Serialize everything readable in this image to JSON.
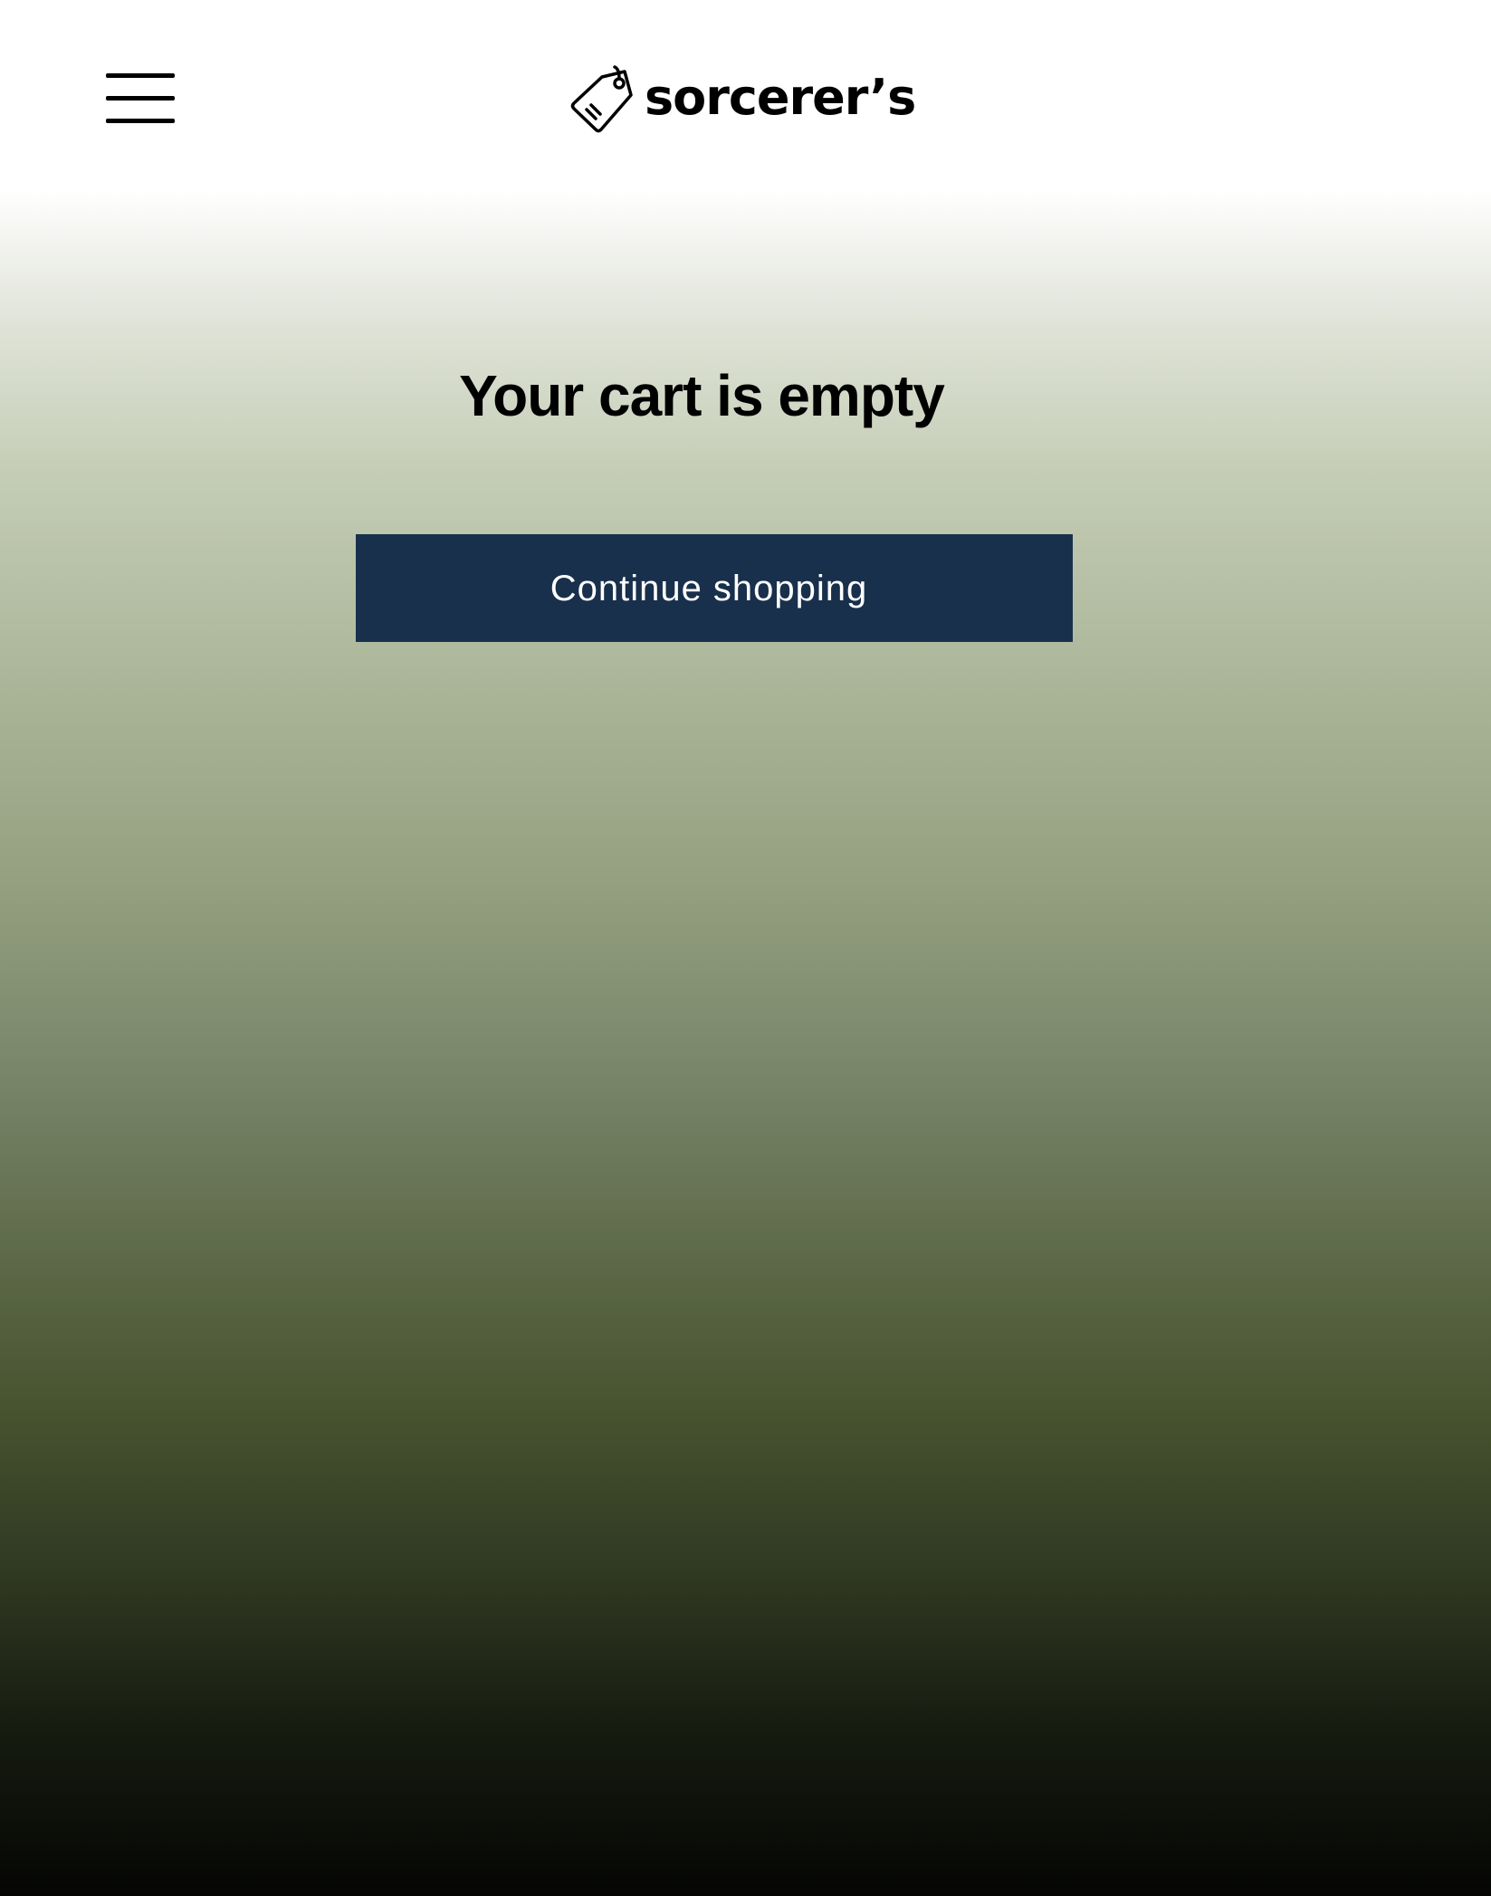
{
  "header": {
    "menu_icon": "hamburger-menu-icon",
    "logo_icon": "price-tag-icon",
    "logo_text": "sorcerer’s"
  },
  "cart": {
    "empty_title": "Your cart is empty",
    "continue_label": "Continue shopping"
  },
  "colors": {
    "button_background": "#18304c",
    "button_text": "#ffffff",
    "gradient_top": "#ffffff",
    "gradient_middle": "#93a07f",
    "gradient_bottom": "#050604"
  }
}
